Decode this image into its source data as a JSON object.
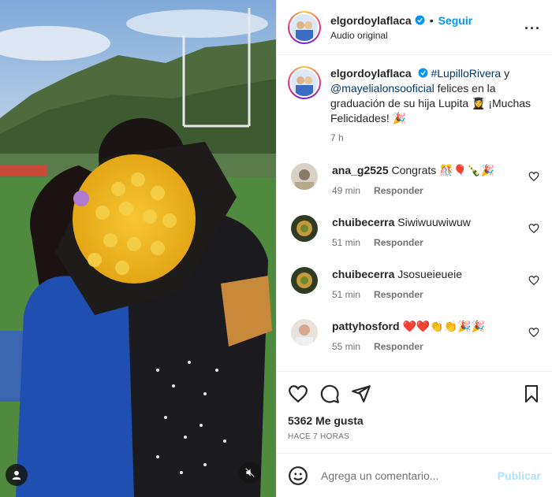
{
  "post": {
    "username": "elgordoylaflaca",
    "follow_label": "Seguir",
    "dot": "•",
    "audio_label": "Audio original",
    "more_label": "···"
  },
  "caption": {
    "username": "elgordoylaflaca",
    "mention1": "#LupilloRivera",
    "connector": " y ",
    "mention2": "@mayelialonsooficial",
    "text": " felices en la graduación de su hija Lupita 👩‍🎓 ¡Muchas Felicidades! 🎉",
    "time": "7 h"
  },
  "comments": [
    {
      "username": "ana_g2525",
      "text": "Congrats 🎊🎈🍾🎉",
      "time": "49 min",
      "reply": "Responder"
    },
    {
      "username": "chuibecerra",
      "text": "Siwiwuuwiwuw",
      "time": "51 min",
      "reply": "Responder"
    },
    {
      "username": "chuibecerra",
      "text": "Jsosueieueie",
      "time": "51 min",
      "reply": "Responder"
    },
    {
      "username": "pattyhosford",
      "text": "❤️❤️👏👏🎉🎉",
      "time": "55 min",
      "reply": "Responder"
    }
  ],
  "stats": {
    "likes": "5362 Me gusta",
    "ago": "HACE 7 HORAS"
  },
  "compose": {
    "placeholder": "Agrega un comentario...",
    "post_label": "Publicar"
  },
  "icons": {
    "like": "heart-icon",
    "comment": "comment-icon",
    "share": "paper-plane-icon",
    "save": "bookmark-icon",
    "emoji": "smiley-icon",
    "verified": "verified-badge-icon",
    "mute": "muted-speaker-icon",
    "tag": "user-tag-icon"
  },
  "colors": {
    "accent": "#0095f6",
    "verified": "#0095f6",
    "muted_text": "#737373",
    "publish_disabled": "#b2dffc"
  }
}
